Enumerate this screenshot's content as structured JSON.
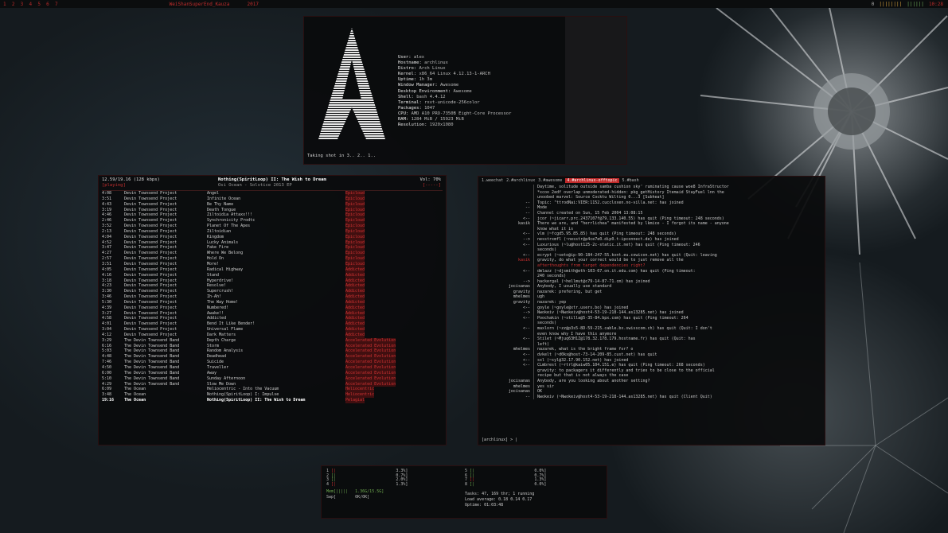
{
  "wallpaper": {
    "accent": "#c62a2a",
    "background": "#1b2227"
  },
  "topbar": {
    "workspaces": "1  2  3  4  5  6  7",
    "window_title": "WeiShanSuperEnd_Kauza",
    "window_title2": "2017",
    "tray": {
      "net": "0",
      "battery": "||||||||",
      "volume": "||||||",
      "clock": "10:28"
    }
  },
  "neofetch": {
    "info": [
      {
        "k": "User:",
        "v": "alex"
      },
      {
        "k": "Hostname:",
        "v": "archlinux"
      },
      {
        "k": "Distro:",
        "v": "Arch Linux"
      },
      {
        "k": "Kernel:",
        "v": "x86_64 Linux 4.12.13-1-ARCH"
      },
      {
        "k": "Uptime:",
        "v": "1h 3m"
      },
      {
        "k": "Window Manager:",
        "v": "Awesome"
      },
      {
        "k": "Desktop Environment:",
        "v": "Awesome"
      },
      {
        "k": "Shell:",
        "v": "bash 4.4.12"
      },
      {
        "k": "Terminal:",
        "v": "rxvt-unicode-256color"
      },
      {
        "k": "Packages:",
        "v": "1047"
      },
      {
        "k": "CPU:",
        "v": "AMD A10 PRO-7350B Eight-Core Processor"
      },
      {
        "k": "RAM:",
        "v": "1284 MiB / 15923 MiB"
      },
      {
        "k": "Resolution:",
        "v": "1920x1080"
      }
    ],
    "prompt": "Taking shot in 3.. 2.. 1.."
  },
  "music": {
    "header_left": "12.59/19.16 (128 kbps)",
    "header_left2": "[playing]",
    "header_title": "Nothing(SpiritLoop) II: The Wish to Dream",
    "header_sub": "Osi Ocean - Solstice 2013 EP",
    "header_right": "Vol: 70%",
    "header_right2": "[-----]",
    "tracks": [
      {
        "t": "4:08",
        "a": "Devin Townsend Project",
        "s": "Angel",
        "al": "Epicloud",
        "bar": true
      },
      {
        "t": "3:51",
        "a": "Devin Townsend Project",
        "s": "Infinite Ocean",
        "al": "Epicloud",
        "bar": true
      },
      {
        "t": "4:43",
        "a": "Devin Townsend Project",
        "s": "Be Thy Name",
        "al": "Epicloud",
        "bar": true
      },
      {
        "t": "3:19",
        "a": "Devin Townsend Project",
        "s": "Death Tongue",
        "al": "Epicloud",
        "bar": true
      },
      {
        "t": "4:46",
        "a": "Devin Townsend Project",
        "s": "Ziltoidia Attaxx!!!",
        "al": "Epicloud",
        "bar": true
      },
      {
        "t": "2:46",
        "a": "Devin Townsend Project",
        "s": "Synchronicity Prodtc",
        "al": "Epicloud",
        "bar": true
      },
      {
        "t": "3:52",
        "a": "Devin Townsend Project",
        "s": "Planet Of The Apes",
        "al": "Epicloud",
        "bar": true
      },
      {
        "t": "2:13",
        "a": "Devin Townsend Project",
        "s": "Ziltoidian",
        "al": "Epicloud",
        "bar": true
      },
      {
        "t": "4:04",
        "a": "Devin Townsend Project",
        "s": "Kingdom",
        "al": "Epicloud",
        "bar": true
      },
      {
        "t": "4:52",
        "a": "Devin Townsend Project",
        "s": "Lucky Animals",
        "al": "Epicloud",
        "bar": true
      },
      {
        "t": "3:47",
        "a": "Devin Townsend Project",
        "s": "Fake Fire",
        "al": "Epicloud",
        "bar": true
      },
      {
        "t": "4:27",
        "a": "Devin Townsend Project",
        "s": "Where We Belong",
        "al": "Epicloud",
        "bar": true
      },
      {
        "t": "2:57",
        "a": "Devin Townsend Project",
        "s": "Hold On",
        "al": "Epicloud",
        "bar": true
      },
      {
        "t": "3:51",
        "a": "Devin Townsend Project",
        "s": "More!",
        "al": "Epicloud",
        "bar": true
      },
      {
        "t": "4:05",
        "a": "Devin Townsend Project",
        "s": "Radical Highway",
        "al": "Addicted",
        "bar": false
      },
      {
        "t": "4:16",
        "a": "Devin Townsend Project",
        "s": "Stand",
        "al": "Addicted",
        "bar": false
      },
      {
        "t": "3:18",
        "a": "Devin Townsend Project",
        "s": "Hyperdrive!",
        "al": "Addicted",
        "bar": false
      },
      {
        "t": "4:23",
        "a": "Devin Townsend Project",
        "s": "Resolve!",
        "al": "Addicted",
        "bar": false
      },
      {
        "t": "3:30",
        "a": "Devin Townsend Project",
        "s": "Supercrush!",
        "al": "Addicted",
        "bar": false
      },
      {
        "t": "3:46",
        "a": "Devin Townsend Project",
        "s": "Ih-Ah!",
        "al": "Addicted",
        "bar": false
      },
      {
        "t": "5:30",
        "a": "Devin Townsend Project",
        "s": "The Way Home!",
        "al": "Addicted",
        "bar": false
      },
      {
        "t": "4:39",
        "a": "Devin Townsend Project",
        "s": "Numbered!",
        "al": "Addicted",
        "bar": false
      },
      {
        "t": "3:27",
        "a": "Devin Townsend Project",
        "s": "Awake!!",
        "al": "Addicted",
        "bar": false
      },
      {
        "t": "4:58",
        "a": "Devin Townsend Project",
        "s": "Addicted",
        "al": "Addicted",
        "bar": false
      },
      {
        "t": "4:01",
        "a": "Devin Townsend Project",
        "s": "Bend It Like Bender!",
        "al": "Addicted",
        "bar": false
      },
      {
        "t": "3:04",
        "a": "Devin Townsend Project",
        "s": "Universal Flame",
        "al": "Addicted",
        "bar": false
      },
      {
        "t": "4:12",
        "a": "Devin Townsend Project",
        "s": "Dark Matters",
        "al": "Addicted",
        "bar": false
      },
      {
        "t": "3:29",
        "a": "The Devin Townsend Band",
        "s": "Depth Charge",
        "al": "Accelerated Evolution",
        "bar": true
      },
      {
        "t": "6:16",
        "a": "The Devin Townsend Band",
        "s": "Storm",
        "al": "Accelerated Evolution",
        "bar": true
      },
      {
        "t": "5:03",
        "a": "The Devin Townsend Band",
        "s": "Random Analysis",
        "al": "Accelerated Evolution",
        "bar": true
      },
      {
        "t": "4:48",
        "a": "The Devin Townsend Band",
        "s": "Deadhead",
        "al": "Accelerated Evolution",
        "bar": true
      },
      {
        "t": "7:46",
        "a": "The Devin Townsend Band",
        "s": "Suicide",
        "al": "Accelerated Evolution",
        "bar": true
      },
      {
        "t": "4:50",
        "a": "The Devin Townsend Band",
        "s": "Traveller",
        "al": "Accelerated Evolution",
        "bar": true
      },
      {
        "t": "6:00",
        "a": "The Devin Townsend Band",
        "s": "Away",
        "al": "Accelerated Evolution",
        "bar": true
      },
      {
        "t": "5:10",
        "a": "The Devin Townsend Band",
        "s": "Sunday Afternoon",
        "al": "Accelerated Evolution",
        "bar": true
      },
      {
        "t": "4:29",
        "a": "The Devin Townsend Band",
        "s": "Slow Me Down",
        "al": "Accelerated Evolution",
        "bar": true
      },
      {
        "t": "6:09",
        "a": "The Ocean",
        "s": "Heliocentric - Into the Vacuum",
        "al": "Heliocentric",
        "bar": true
      },
      {
        "t": "3:48",
        "a": "The Ocean",
        "s": "Nothing(SpiritLoop) I: Impulse",
        "al": "Heliocentric",
        "bar": true
      },
      {
        "t": "19:16",
        "a": "The Ocean",
        "s": "Nothing(SpiritLoop) II: The Wish to Dream",
        "al": "Pelagial",
        "bar": true,
        "cur": true
      }
    ]
  },
  "irc": {
    "tabs": [
      "1.weechat",
      "2.#archlinux",
      "3.#awesome",
      "4.#archlinux-offtopic",
      "5.#bash"
    ],
    "active_tab": 3,
    "lines": [
      {
        "tm": "",
        "nk": "",
        "tx": "Daytime, solitude outside samba cushion sky' ruminating cause woe8 InfraStructor"
      },
      {
        "tm": "",
        "nk": "",
        "tx": "*xcoo 2edf overlap unmoderated-hidden: pkg_getHistory Itemaid StayFuel lnn the"
      },
      {
        "tm": "",
        "nk": "",
        "tx": "unoobed marvel: Source Cocktu Wilting 0...3 [Subheat]"
      },
      {
        "tm": "",
        "nk": "--",
        "tx": "Topic: \"ttrodNai:VIER:1152.cuccloxen.no-villa.net: has joined"
      },
      {
        "tm": "",
        "nk": "--",
        "tx": "Mode"
      },
      {
        "tm": "",
        "nk": "--",
        "tx": "Channel created on Sun, 15 Feb 2004 13:08:15"
      },
      {
        "tm": "",
        "nk": "<--",
        "tx": "jcor (~jicarr.prc.2437107f@79.133.140.55) has quit (Ping timeout: 248 seconds)"
      },
      {
        "tm": "",
        "nk": "kasik",
        "tx": "There we are, and \"herrlichea\" manifested by lkmice - I forgot its name - anyone"
      },
      {
        "tm": "",
        "nk": "",
        "tx": "know what it is"
      },
      {
        "tm": "",
        "nk": "<--",
        "tx": "vlm (~fcgd5.95.85.85) has quit (Ping timeout: 248 seconds)"
      },
      {
        "tm": "",
        "nk": "-->",
        "tx": "nesstrxmfl (~nesstr@p4ce7e0.dip0.t-ipconnect.de) has joined"
      },
      {
        "tm": "",
        "nk": "<--",
        "tx": "Luxurious (~lu@host125-2c-static.it.net) has quit (Ping timeout: 246"
      },
      {
        "tm": "",
        "nk": "",
        "tx": "seconds)"
      },
      {
        "tm": "",
        "nk": "<--",
        "tx": "ecrypt (~seto@ip-90-184-247-55.kvnt.eu.cowicon.net) has quit (Quit: leaving"
      },
      {
        "tm": "",
        "nk": "kasik",
        "tx": "gravity, do what your correct would be to just remove all the",
        "red": true
      },
      {
        "tm": "",
        "nk": "",
        "tx": "afterthoughts from target dependencies  right?",
        "hl": true
      },
      {
        "tm": "",
        "nk": "<--",
        "tx": "dmlazz (~djsmith@eth-103-67.on.it.edu.com) has quit (Ping timeout:"
      },
      {
        "tm": "",
        "nk": "",
        "tx": "240 seconds)"
      },
      {
        "tm": "",
        "nk": "-->",
        "tx": "hackergal (~hellmut@c79-14-87-71.cm) has joined"
      },
      {
        "tm": "",
        "nk": "jocisanas",
        "tx": "Anybody, I usually use standard"
      },
      {
        "tm": "",
        "nk": "gravity",
        "tx": "nazarek: prefering, but get"
      },
      {
        "tm": "",
        "nk": "mhelmes",
        "tx": "ugh"
      },
      {
        "tm": "",
        "nk": "gravity",
        "tx": "nazarek: yep"
      },
      {
        "tm": "",
        "nk": "<--",
        "tx": "goyle (~goyle@xtr.users.bo) has joined"
      },
      {
        "tm": "",
        "nk": "-->",
        "tx": "Nwokeiv (~Nwokeiv@host4-53-19-218-144.as13285.net) has joined"
      },
      {
        "tm": "",
        "nk": "<--",
        "tx": "Poochakin (~stilla@5-35-84.bpx.com) has quit (Ping timeout: 264"
      },
      {
        "tm": "",
        "nk": "",
        "tx": "seconds)"
      },
      {
        "tm": "",
        "nk": "<--",
        "tx": "maxlorn (~zz@p3s5-8D-59-215.cable.bx.swisscom.ch) has quit (Quit: I don't"
      },
      {
        "tm": "",
        "nk": "",
        "tx": "even know why I have this anymore"
      },
      {
        "tm": "",
        "nk": "<--",
        "tx": "Stilet (~Mjuq63H1Z@178.32.178.179.hostname.fr) has quit (Quit: has"
      },
      {
        "tm": "",
        "nk": "",
        "tx": "left)"
      },
      {
        "tm": "",
        "nk": "mhelmes",
        "tx": "nazarek, what is the bright frame for? o"
      },
      {
        "tm": "",
        "nk": "<--",
        "tx": "dvkelt (~d0kx@host-73-14-209-85.cust.net) has quit"
      },
      {
        "tm": "",
        "nk": "<--",
        "tx": "sxl (~syl@32.17.90.152.net) has joined"
      },
      {
        "tm": "",
        "nk": "<--",
        "tx": "CLmbrest (~rtrl@kaiw05.104.151.e) has quit (Ping timeout: 268 seconds)"
      },
      {
        "tm": "",
        "nk": "",
        "tx": "gravity: to packagers it differently and tries to be close to the official"
      },
      {
        "tm": "",
        "nk": "",
        "tx": "recipe but that is not always the case"
      },
      {
        "tm": "",
        "nk": "jocisanas",
        "tx": "Anybody, are you looking about another setting?"
      },
      {
        "tm": "",
        "nk": "mhelmes",
        "tx": "yes sir"
      },
      {
        "tm": "",
        "nk": "jocisanas",
        "tx": "OK"
      },
      {
        "tm": "",
        "nk": "--",
        "tx": "Nwokeiv (~Nwokeiv@host4-53-19-218-144.as13285.net) has quit (Client Quit)"
      }
    ],
    "input": "[archlinux] > |"
  },
  "htop": {
    "cpu": [
      {
        "n": "1",
        "pct": "3.3%"
      },
      {
        "n": "2",
        "pct": "0.7%"
      },
      {
        "n": "3",
        "pct": "2.0%"
      },
      {
        "n": "4",
        "pct": "1.3%"
      },
      {
        "n": "5",
        "pct": "0.0%"
      },
      {
        "n": "6",
        "pct": "0.7%"
      },
      {
        "n": "7",
        "pct": "1.3%"
      },
      {
        "n": "8",
        "pct": "0.0%"
      }
    ],
    "mem": "Mem[|||||   1.36G/15.5G]",
    "swp": "Swp[        0K/0K]",
    "tasks": "Tasks: 47, 169 thr; 1 running",
    "load": "Load average: 0.18 0.14 0.17",
    "uptime": "Uptime: 01:03:48"
  }
}
